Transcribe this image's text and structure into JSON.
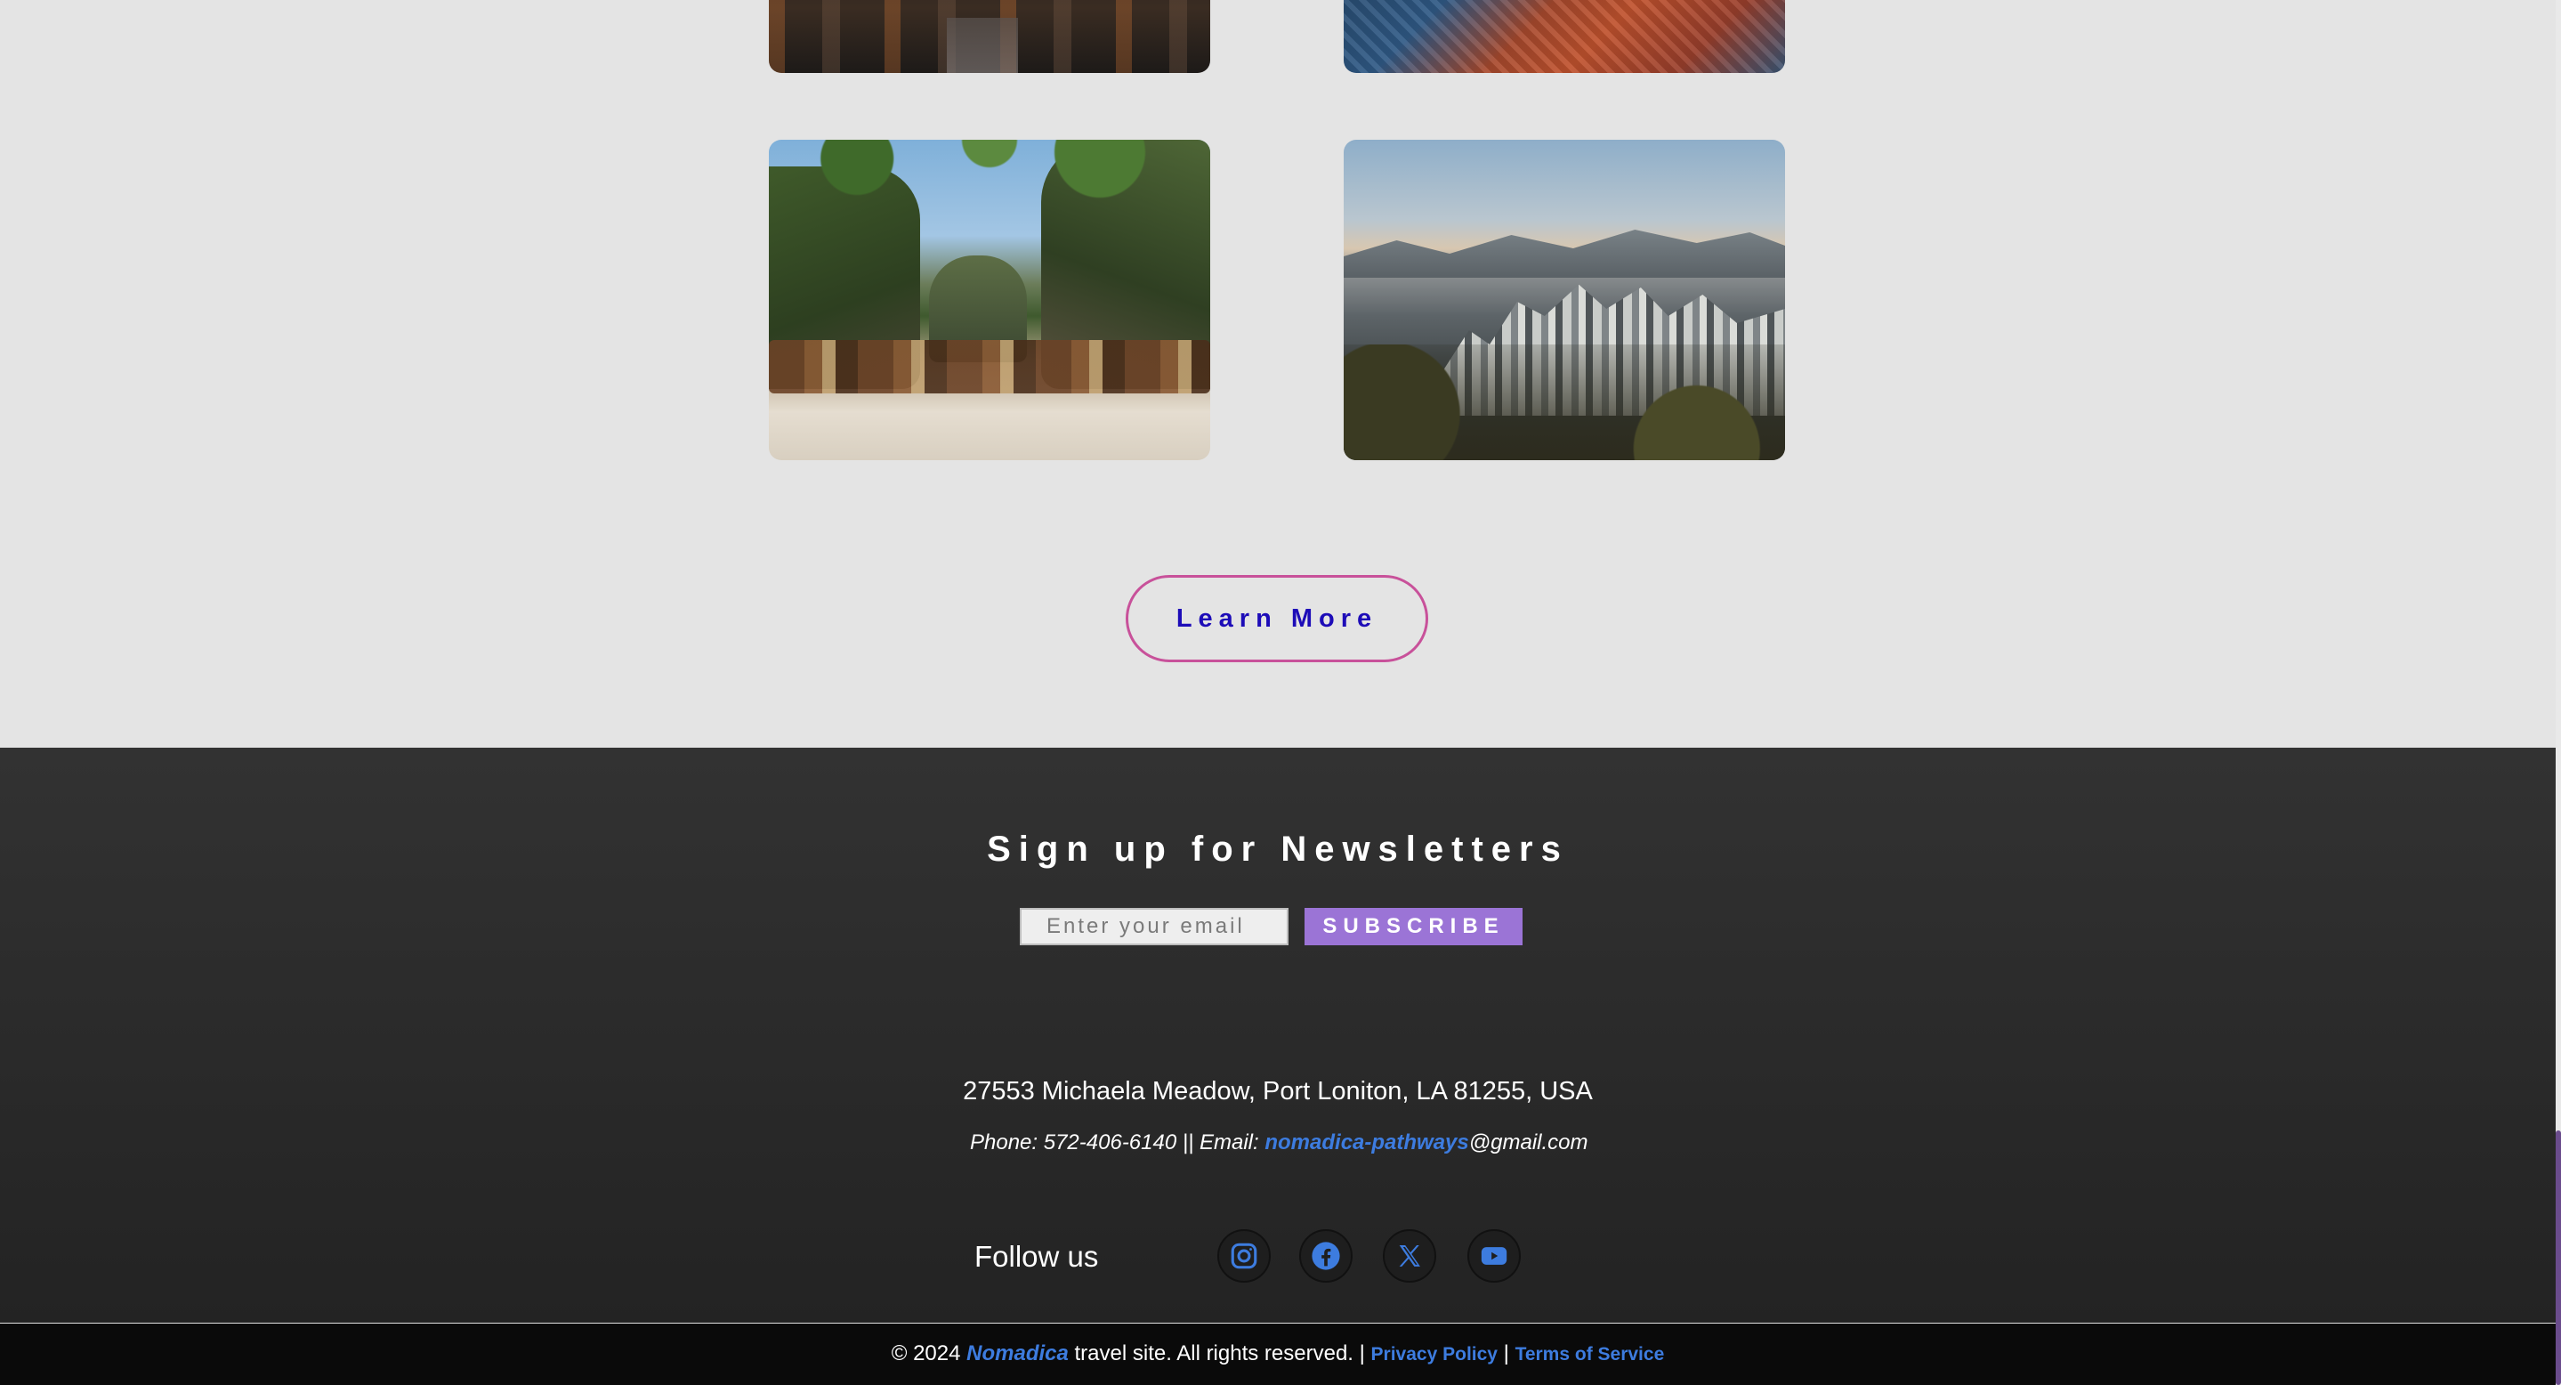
{
  "gallery": {
    "photos": [
      {
        "icon": "street-photo"
      },
      {
        "icon": "rooftops-photo"
      },
      {
        "icon": "beach-boats-photo"
      },
      {
        "icon": "city-skyline-photo"
      }
    ],
    "learn_more_label": "Learn More"
  },
  "newsletter": {
    "title": "Sign up for Newsletters",
    "email_placeholder": "Enter your email",
    "subscribe_label": "SUBSCRIBE"
  },
  "contact": {
    "address": "27553 Michaela Meadow, Port Loniton, LA 81255, USA",
    "phone_prefix": "Phone: 572-406-6140 || Email: ",
    "email_user": "nomadica-pathways",
    "email_domain": "@gmail.com"
  },
  "social": {
    "follow_label": "Follow us",
    "icons": [
      "instagram-icon",
      "facebook-icon",
      "x-icon",
      "youtube-icon"
    ]
  },
  "footer": {
    "copyright_prefix": "© 2024 ",
    "brand": "Nomadica",
    "copyright_suffix": " travel site. All rights reserved. | ",
    "privacy_label": "Privacy Policy",
    "separator": " | ",
    "terms_label": "Terms of Service"
  },
  "colors": {
    "accent_blue": "#3d7cdf",
    "button_purple": "#9b74d6",
    "learn_more_border": "#c8519a",
    "learn_more_text": "#1d0cb8"
  }
}
